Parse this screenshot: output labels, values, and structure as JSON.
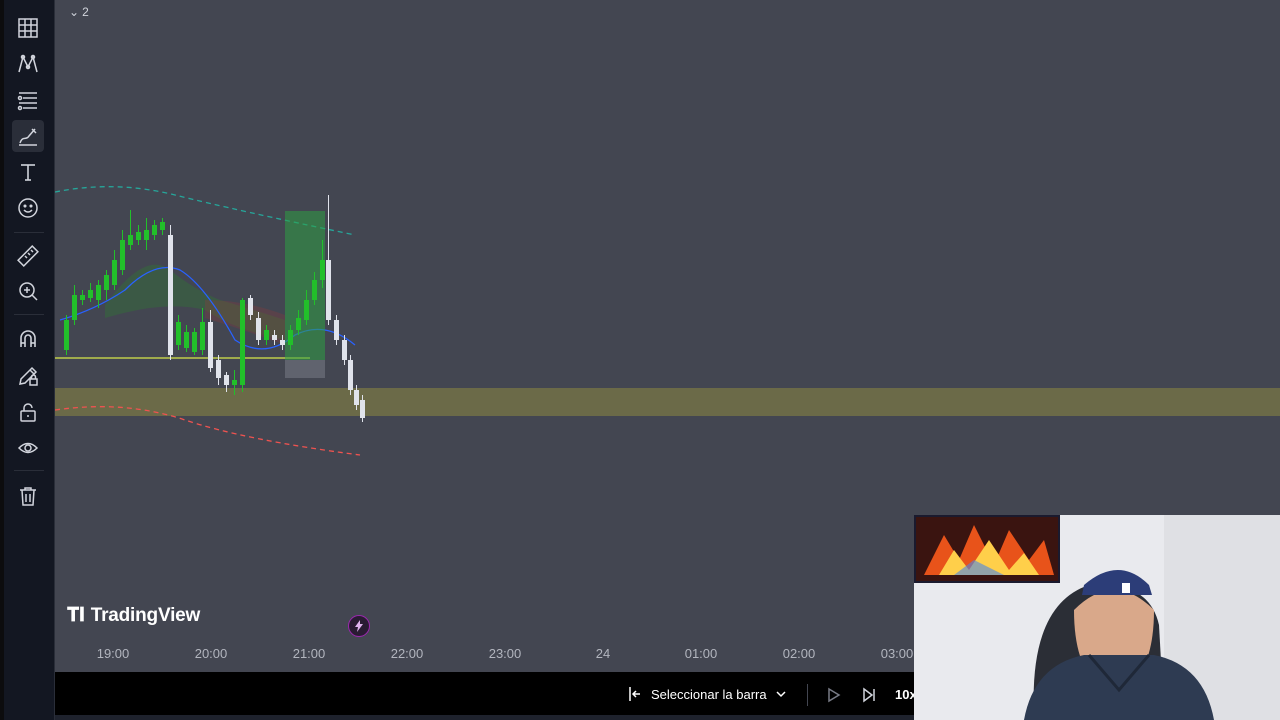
{
  "toolbar": {
    "tools": [
      {
        "name": "grid-icon",
        "active": false
      },
      {
        "name": "pattern-icon",
        "active": false
      },
      {
        "name": "fib-icon",
        "active": false
      },
      {
        "name": "brush-icon",
        "active": true
      },
      {
        "name": "text-icon",
        "active": false
      },
      {
        "name": "emoji-icon",
        "active": false
      },
      {
        "name": "ruler-icon",
        "active": false
      },
      {
        "name": "zoom-icon",
        "active": false
      },
      {
        "name": "magnet-icon",
        "active": false
      },
      {
        "name": "stay-drawing-icon",
        "active": false
      },
      {
        "name": "lock-icon",
        "active": false
      },
      {
        "name": "eye-icon",
        "active": false
      },
      {
        "name": "trash-icon",
        "active": false
      }
    ]
  },
  "pane": {
    "collapse_count": "2"
  },
  "logo": {
    "text": "TradingView"
  },
  "time_axis": {
    "labels": [
      "19:00",
      "20:00",
      "21:00",
      "22:00",
      "23:00",
      "24",
      "01:00",
      "02:00",
      "03:00"
    ]
  },
  "replay": {
    "select_label": "Seleccionar la barra",
    "speed": "10x"
  },
  "colors": {
    "background": "#434651",
    "up_candle": "#22c02a",
    "down_candle": "#e0e3eb",
    "zone": "#6b6a48",
    "horizontal_line": "#d7e84a",
    "upper_band": "#26a69a",
    "lower_band": "#ef5350",
    "ma_line": "#2962ff",
    "long_position": "#2e9e44"
  }
}
